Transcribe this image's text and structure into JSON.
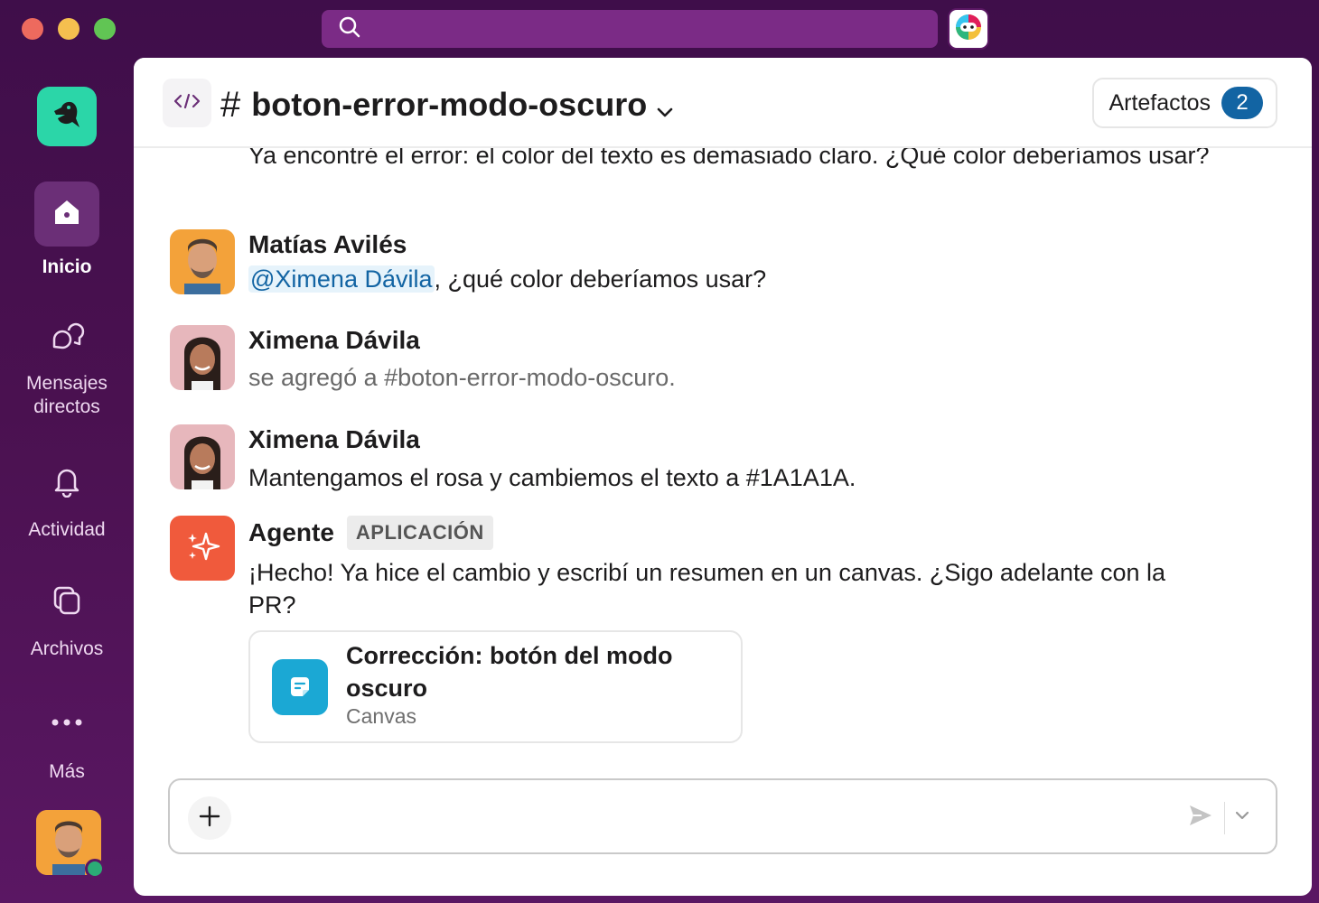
{
  "window": {
    "controls": [
      "close",
      "minimize",
      "zoom"
    ]
  },
  "search": {
    "icon": "search-icon",
    "placeholder": ""
  },
  "sidebar": {
    "items": [
      {
        "label": "Inicio",
        "icon": "home-icon",
        "active": true
      },
      {
        "label": "Mensajes\ndirectos",
        "icon": "direct-messages-icon",
        "active": false
      },
      {
        "label": "Actividad",
        "icon": "bell-icon",
        "active": false
      },
      {
        "label": "Archivos",
        "icon": "files-icon",
        "active": false
      },
      {
        "label": "Más",
        "icon": "more-icon",
        "active": false
      }
    ],
    "presence_color": "#2bac76"
  },
  "header": {
    "hash": "#",
    "channel_name": "boton-error-modo-oscuro",
    "artifacts_label": "Artefactos",
    "artifacts_count": "2"
  },
  "messages": [
    {
      "text": "Ya encontré el error: el color del texto es demasiado claro. ¿Qué color deberíamos usar?"
    },
    {
      "sender": "Matías Avilés",
      "mention": "@Ximena Dávila",
      "text": ", ¿qué color deberíamos usar?"
    },
    {
      "sender": "Ximena Dávila",
      "text": "se agregó a #boton-error-modo-oscuro."
    },
    {
      "sender": "Ximena Dávila",
      "text": "Mantengamos el rosa y cambiemos el texto a #1A1A1A."
    },
    {
      "sender": "Agente",
      "tag": "APLICACIÓN",
      "text": "¡Hecho! Ya hice el cambio y escribí un resumen en un canvas. ¿Sigo adelante con la PR?"
    }
  ],
  "canvas": {
    "title": "Corrección: botón del modo oscuro",
    "subtitle": "Canvas"
  },
  "composer": {
    "placeholder": ""
  },
  "colors": {
    "sidebar_bg": "#4a1150",
    "accent_blue": "#1264a3",
    "agent_orange": "#f05a3c",
    "canvas_blue": "#1ba8d4",
    "logo_green": "#2bd6a8"
  }
}
